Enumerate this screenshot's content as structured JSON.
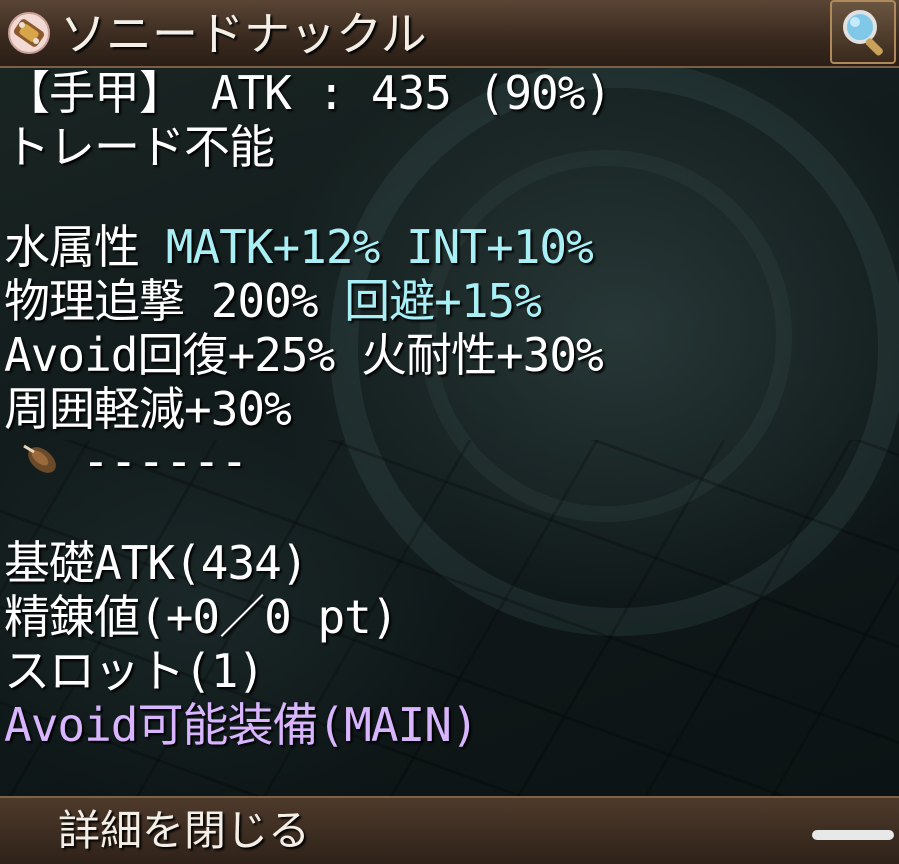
{
  "header": {
    "title": "ソニードナックル",
    "icon": "knuckle-item-icon",
    "zoom_icon": "magnifier-icon"
  },
  "stats": {
    "line1": "【手甲】 ATK : 435 (90%)",
    "line2": "トレード不能",
    "line3_a": "水属性 ",
    "line3_b": "MATK+12% INT+10%",
    "line4_a": "物理追撃 200% ",
    "line4_b": "回避+15%",
    "line5": "Avoid回復+25% 火耐性+30%",
    "line6": "周囲軽減+30%",
    "slot": "------",
    "base_atk": "基礎ATK(434)",
    "refine": "精錬値(+0／0 pt)",
    "slots": "スロット(1)",
    "equip": "Avoid可能装備(MAIN)"
  },
  "footer": {
    "close_label": "詳細を閉じる"
  },
  "colors": {
    "highlight": "#a8f0f6",
    "special": "#d9b5ff",
    "frame": "#5a4535"
  }
}
